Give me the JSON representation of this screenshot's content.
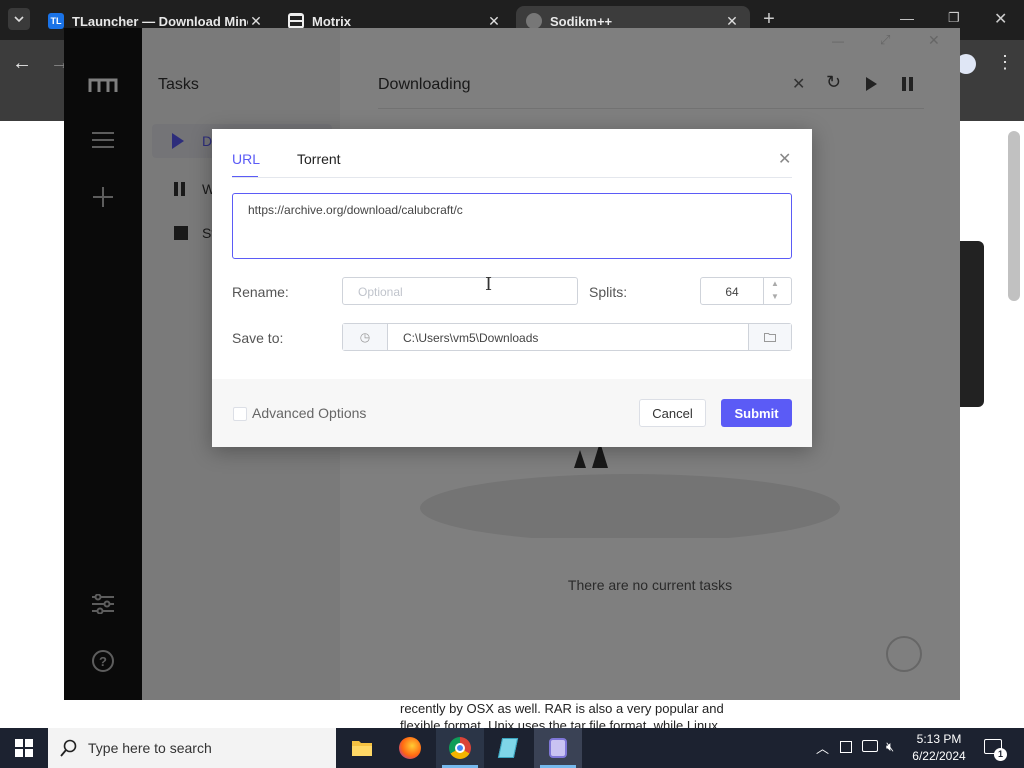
{
  "browser": {
    "tabs": [
      {
        "icon": "tlauncher-favicon",
        "icon_text": "TL",
        "title": "TLauncher — Download Mine"
      },
      {
        "icon": "motrix-favicon",
        "title": "Motrix"
      },
      {
        "icon": "chrome-favicon",
        "title": "Sodikm++"
      }
    ],
    "page_snippet_line1": "recently by OSX as well. RAR is also a very popular and",
    "page_snippet_line2": "flexible format. Unix uses the tar file format, while Linux"
  },
  "motrix": {
    "nav_title": "Tasks",
    "nav_items": [
      {
        "label": "Do",
        "icon": "play-icon"
      },
      {
        "label": "W",
        "icon": "pause-icon"
      },
      {
        "label": "St",
        "icon": "stop-icon"
      }
    ],
    "main_title": "Downloading",
    "empty_message": "There are no current tasks"
  },
  "dialog": {
    "tabs": [
      "URL",
      "Torrent"
    ],
    "active_tab": "URL",
    "url_value": "https://archive.org/download/calubcraft/c",
    "rename_label": "Rename:",
    "rename_placeholder": "Optional",
    "splits_label": "Splits:",
    "splits_value": "64",
    "save_to_label": "Save to:",
    "save_to_value": "C:\\Users\\vm5\\Downloads",
    "advanced_label": "Advanced Options",
    "cancel_label": "Cancel",
    "submit_label": "Submit"
  },
  "taskbar": {
    "search_placeholder": "Type here to search",
    "time": "5:13 PM",
    "date": "6/22/2024",
    "notification_count": "1"
  },
  "colors": {
    "accent": "#5b5bf6",
    "sidebar": "#141414",
    "taskbar": "#1c2230"
  }
}
